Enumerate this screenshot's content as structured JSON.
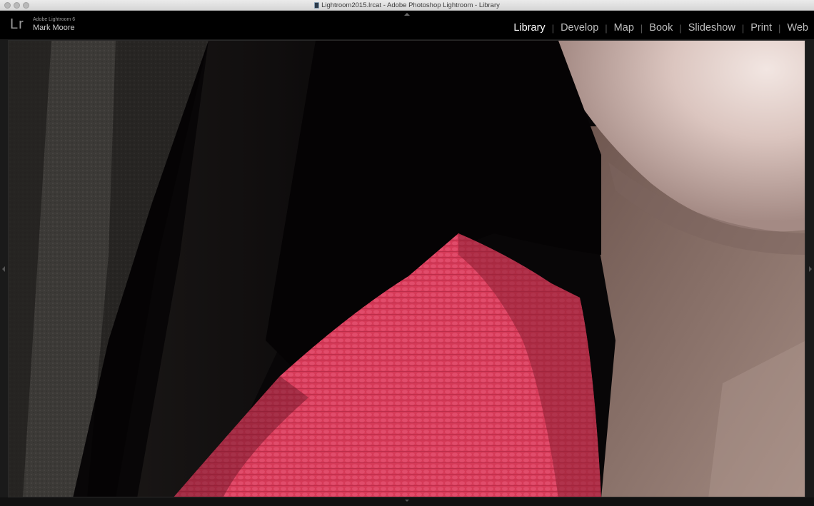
{
  "window": {
    "title": "Lightroom2015.lrcat - Adobe Photoshop Lightroom - Library"
  },
  "identity": {
    "logo": "Lr",
    "product": "Adobe Lightroom 6",
    "user": "Mark Moore"
  },
  "modules": {
    "items": [
      {
        "label": "Library",
        "active": true
      },
      {
        "label": "Develop"
      },
      {
        "label": "Map"
      },
      {
        "label": "Book"
      },
      {
        "label": "Slideshow"
      },
      {
        "label": "Print"
      },
      {
        "label": "Web"
      }
    ],
    "separator": "|"
  },
  "icons": {
    "close": "close-icon",
    "minimize": "minimize-icon",
    "zoom": "zoom-icon",
    "document": "document-icon",
    "panel_top": "panel-collapse-top-icon",
    "panel_left": "panel-collapse-left-icon",
    "panel_right": "panel-collapse-right-icon",
    "panel_bottom": "panel-collapse-bottom-icon"
  },
  "colors": {
    "active_module": "#ffffff",
    "inactive_module": "#bdbdbd",
    "background": "#000000"
  }
}
